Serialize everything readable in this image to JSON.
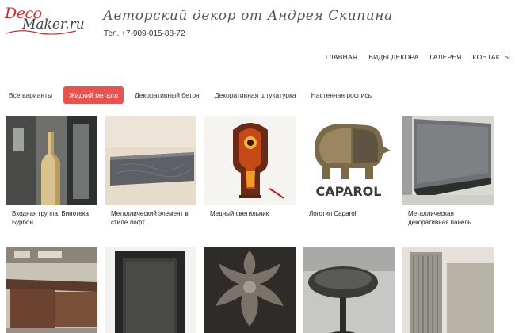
{
  "header": {
    "logo_top": "Deco",
    "logo_bottom": "Maker.ru",
    "tagline": "Авторский декор от Андрея Скипина",
    "phone": "Тел. +7-909-015-88-72"
  },
  "nav": {
    "items": [
      "ГЛАВНАЯ",
      "ВИДЫ ДЕКОРА",
      "ГАЛЕРЕЯ",
      "КОНТАКТЫ"
    ]
  },
  "filters": {
    "items": [
      "Все варианты",
      "Жидкий металл",
      "Декоративный бетон",
      "Декоративная штукатурка",
      "Настенная роспись"
    ],
    "active_index": 1
  },
  "gallery": {
    "row1": [
      {
        "caption": "Входная группа. Винотека Бурбон"
      },
      {
        "caption": "Металлический элемент в стиле лофт..."
      },
      {
        "caption": "Медный светильник"
      },
      {
        "caption": "Логотип Caparol"
      },
      {
        "caption": "Металлическая декоративная панель"
      }
    ],
    "caparol_label": "CAPAROL"
  },
  "colors": {
    "accent": "#e9524e",
    "logo_red": "#c9302c"
  }
}
